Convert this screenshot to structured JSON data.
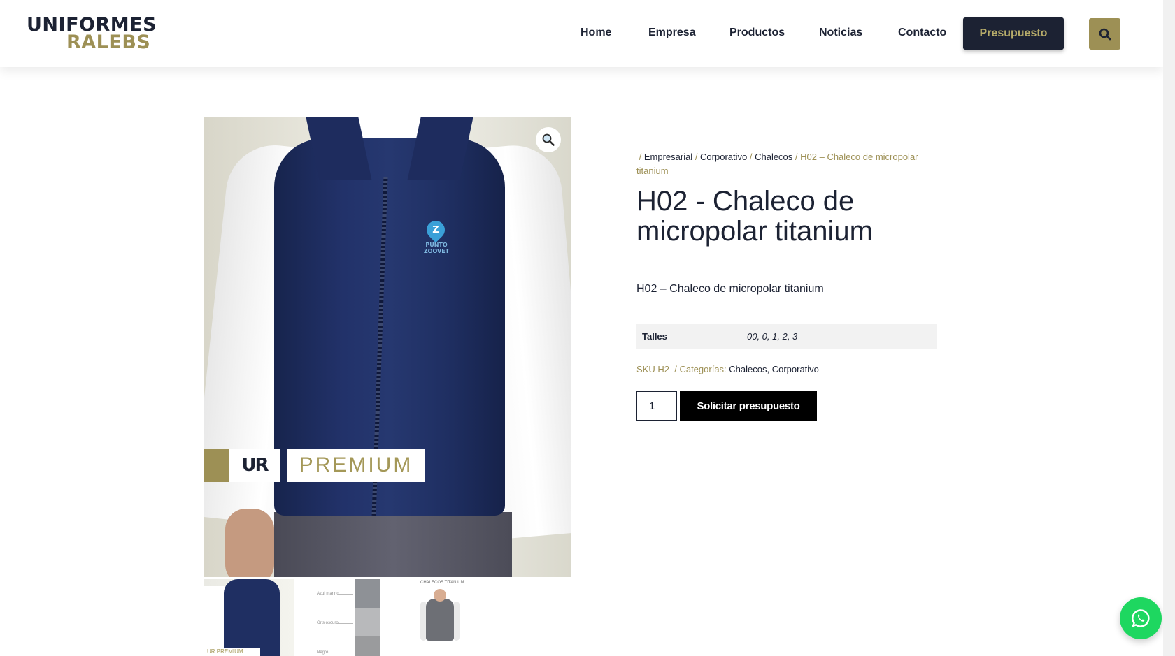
{
  "header": {
    "logo": {
      "line1": "UNIFORMES",
      "line2": "RALEBS"
    },
    "nav": [
      {
        "label": "Home"
      },
      {
        "label": "Empresa"
      },
      {
        "label": "Productos"
      },
      {
        "label": "Noticias"
      },
      {
        "label": "Contacto"
      }
    ],
    "cta_label": "Presupuesto",
    "search_icon": "search-icon"
  },
  "gallery": {
    "badge_ur": "UR",
    "badge_premium": "PREMIUM",
    "emblem_letter": "Z",
    "emblem_text": "PUNTO ZOOVET",
    "zoom_icon": "magnifier-icon",
    "thumb1_label": "UR PREMIUM",
    "thumb2_labels": [
      "Azul marino",
      "Gris oscuro",
      "Negro"
    ],
    "thumb3_title": "CHALECOS TITANIUM"
  },
  "product": {
    "breadcrumb": [
      {
        "label": "Empresarial"
      },
      {
        "label": "Corporativo"
      },
      {
        "label": "Chalecos"
      }
    ],
    "breadcrumb_current": "H02 – Chaleco de micropolar titanium",
    "title": "H02 - Chaleco de micropolar titanium",
    "short_description": "H02 – Chaleco de micropolar titanium",
    "attributes": [
      {
        "label": "Talles",
        "value": "00, 0, 1, 2, 3"
      }
    ],
    "sku_label": "SKU",
    "sku": "H2",
    "categories_label": "Categorías:",
    "categories": [
      "Chalecos",
      "Corporativo"
    ],
    "quantity": "1",
    "request_label": "Solicitar presupuesto"
  },
  "colors": {
    "navy": "#1c2233",
    "gold": "#9d9055",
    "whatsapp": "#1ed760"
  }
}
